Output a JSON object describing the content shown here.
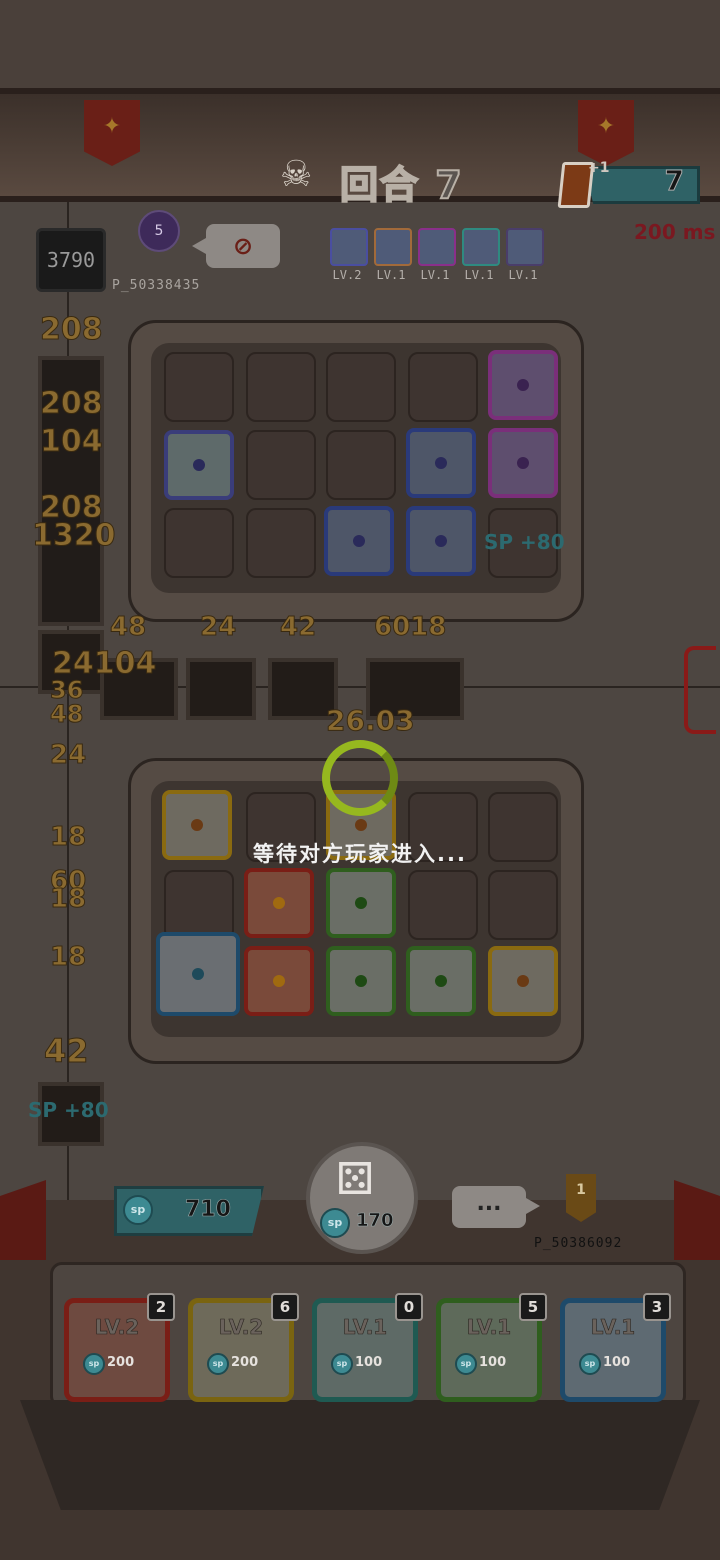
{
  "header": {
    "round_label": "回合 7",
    "card_plus": "+1",
    "card_count": "7",
    "ping": "200 ms"
  },
  "opponent": {
    "score": "3790",
    "rank": "5",
    "name": "P_50338435",
    "emote": "⊘",
    "deck": [
      {
        "level": "LV.2",
        "color": "#4a4ea0"
      },
      {
        "level": "LV.1",
        "color": "#a26a3a"
      },
      {
        "level": "LV.1",
        "color": "#8a2f8a"
      },
      {
        "level": "LV.1",
        "color": "#2f8a80"
      },
      {
        "level": "LV.1",
        "color": "#4a3d6a"
      }
    ]
  },
  "floating_numbers": {
    "left": [
      "208",
      "208",
      "104",
      "208",
      "1320",
      "24104",
      "36",
      "48",
      "24",
      "18",
      "60",
      "18",
      "18",
      "42"
    ],
    "row": [
      "48",
      "24",
      "42",
      "6018"
    ],
    "center": "26.03",
    "sp_gain": "SP +80"
  },
  "waiting_text": "等待对方玩家进入...",
  "player": {
    "sp": "710",
    "roll_cost": "170",
    "chat": "...",
    "name": "P_50386092",
    "rank": "1"
  },
  "deck": [
    {
      "level": "LV.2",
      "cost": "200",
      "count": "2",
      "color": "#7a1e16"
    },
    {
      "level": "LV.2",
      "cost": "200",
      "count": "6",
      "color": "#7a6410"
    },
    {
      "level": "LV.1",
      "cost": "100",
      "count": "0",
      "color": "#1f5a52"
    },
    {
      "level": "LV.1",
      "cost": "100",
      "count": "5",
      "color": "#2f5e1e"
    },
    {
      "level": "LV.1",
      "cost": "100",
      "count": "3",
      "color": "#1e4a6a"
    }
  ],
  "sp_badge": "sp"
}
